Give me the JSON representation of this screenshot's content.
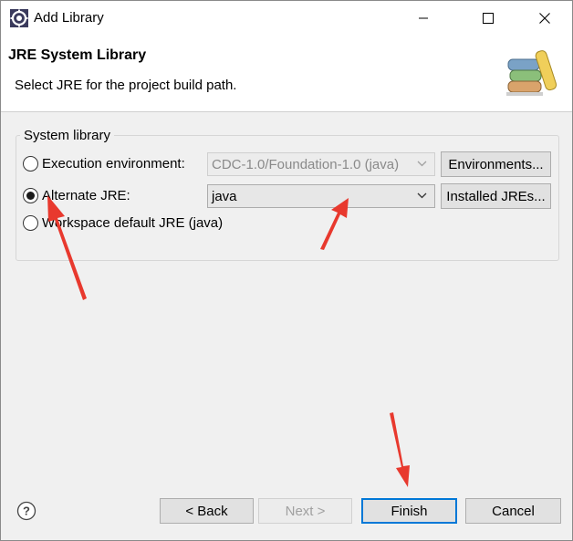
{
  "window": {
    "title": "Add Library",
    "controls": {
      "minimize": "minimize",
      "maximize": "maximize",
      "close": "close"
    }
  },
  "header": {
    "title": "JRE System Library",
    "description": "Select JRE for the project build path."
  },
  "group": {
    "legend": "System library",
    "options": [
      {
        "label": "Execution environment:",
        "selected": false,
        "combo_value": "CDC-1.0/Foundation-1.0 (java)",
        "combo_enabled": false,
        "button": "Environments..."
      },
      {
        "label": "Alternate JRE:",
        "selected": true,
        "combo_value": "java",
        "combo_enabled": true,
        "button": "Installed JREs..."
      },
      {
        "label": "Workspace default JRE (java)",
        "selected": false
      }
    ]
  },
  "footer": {
    "back": "< Back",
    "next": "Next >",
    "finish": "Finish",
    "cancel": "Cancel"
  },
  "colors": {
    "accent": "#0078d7",
    "annotation_arrow": "#e8392e"
  },
  "icons": [
    "eclipse-gear-icon",
    "library-books-icon",
    "help-icon",
    "chevron-down-icon"
  ]
}
